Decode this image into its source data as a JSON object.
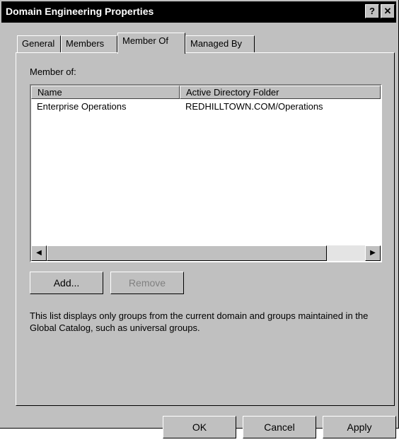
{
  "window": {
    "title": "Domain Engineering Properties",
    "help_label": "?",
    "close_label": "✕"
  },
  "tabs": [
    {
      "label": "General"
    },
    {
      "label": "Members"
    },
    {
      "label": "Member Of"
    },
    {
      "label": "Managed By"
    }
  ],
  "panel": {
    "member_of_label": "Member of:",
    "columns": [
      "Name",
      "Active Directory Folder"
    ],
    "rows": [
      {
        "name": "Enterprise Operations",
        "folder": "REDHILLTOWN.COM/Operations"
      }
    ],
    "add_label": "Add...",
    "remove_label": "Remove",
    "info_text": "This list displays only groups from the current domain and groups maintained in the Global Catalog, such as universal groups."
  },
  "footer": {
    "ok_label": "OK",
    "cancel_label": "Cancel",
    "apply_label": "Apply"
  }
}
